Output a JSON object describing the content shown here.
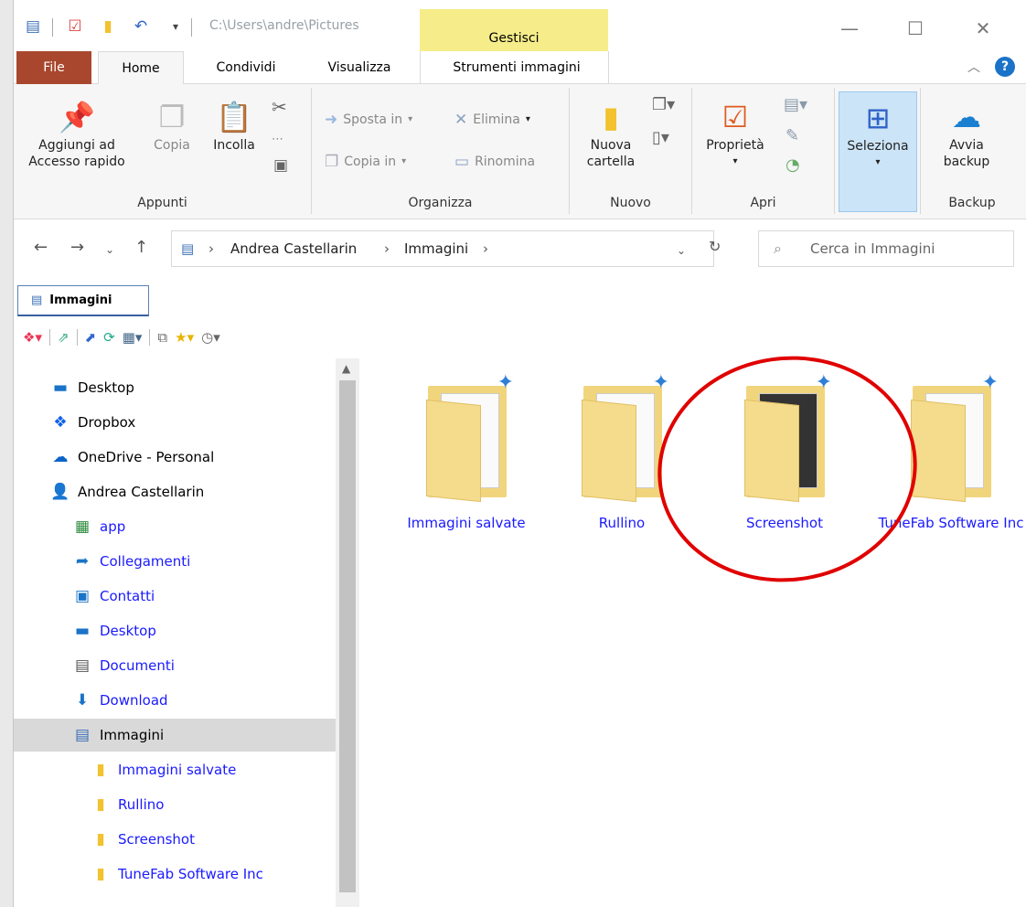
{
  "title": {
    "path": "C:\\Users\\andre\\Pictures",
    "contextual_tab": "Gestisci"
  },
  "tabs": {
    "file": "File",
    "home": "Home",
    "share": "Condividi",
    "view": "Visualizza",
    "picture_tools": "Strumenti immagini"
  },
  "ribbon": {
    "clipboard": {
      "label": "Appunti",
      "pin": "Aggiungi ad Accesso rapido",
      "copy": "Copia",
      "paste": "Incolla"
    },
    "organize": {
      "label": "Organizza",
      "move_to": "Sposta in",
      "copy_to": "Copia in",
      "delete": "Elimina",
      "rename": "Rinomina"
    },
    "new": {
      "label": "Nuovo",
      "new_folder": "Nuova cartella"
    },
    "open": {
      "label": "Apri",
      "properties": "Proprietà"
    },
    "select": {
      "label": "Seleziona"
    },
    "backup": {
      "label": "Backup",
      "start_backup": "Avvia backup"
    }
  },
  "address": {
    "crumbs": [
      "Andrea Castellarin",
      "Immagini"
    ],
    "search_placeholder": "Cerca in Immagini"
  },
  "legacy_tab": "Immagini",
  "nav": {
    "items": [
      {
        "label": "Desktop"
      },
      {
        "label": "Dropbox"
      },
      {
        "label": "OneDrive - Personal"
      },
      {
        "label": "Andrea Castellarin"
      },
      {
        "label": "app"
      },
      {
        "label": "Collegamenti"
      },
      {
        "label": "Contatti"
      },
      {
        "label": "Desktop"
      },
      {
        "label": "Documenti"
      },
      {
        "label": "Download"
      },
      {
        "label": "Immagini"
      },
      {
        "label": "Immagini salvate"
      },
      {
        "label": "Rullino"
      },
      {
        "label": "Screenshot"
      },
      {
        "label": "TuneFab Software Inc"
      }
    ],
    "selected": "Immagini"
  },
  "folders": [
    {
      "label": "Immagini salvate"
    },
    {
      "label": "Rullino"
    },
    {
      "label": "Screenshot"
    },
    {
      "label": "TuneFab Software Inc"
    }
  ],
  "colors": {
    "file_tab": "#a8472d",
    "contextual_tab": "#f6ed8a",
    "link_blue": "#1a1aff",
    "annotation_red": "#e00000"
  }
}
